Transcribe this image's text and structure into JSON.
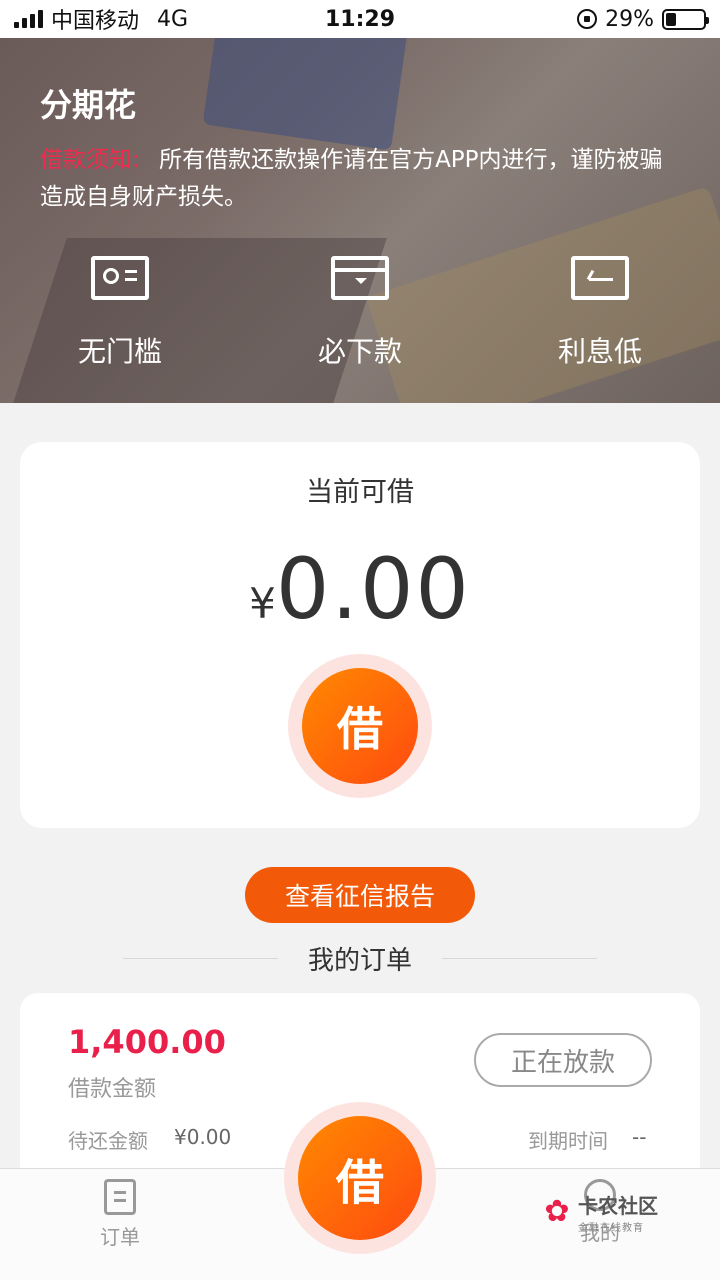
{
  "status_bar": {
    "carrier": "中国移动",
    "network": "4G",
    "time": "11:29",
    "battery": "29%",
    "battery_level": 0.29
  },
  "hero": {
    "title": "分期花",
    "notice_label": "借款须知:",
    "notice_text": "所有借款还款操作请在官方APP内进行，谨防被骗造成自身财产损失。",
    "features": [
      {
        "label": "无门槛",
        "icon": "id-card-icon"
      },
      {
        "label": "必下款",
        "icon": "card-icon"
      },
      {
        "label": "利息低",
        "icon": "low-rate-icon"
      }
    ]
  },
  "loan": {
    "caption": "当前可借",
    "currency": "¥",
    "amount": "0.00",
    "borrow_label": "借"
  },
  "credit_report_label": "查看征信报告",
  "orders_title": "我的订单",
  "order": {
    "amount": "1,400.00",
    "amount_label": "借款金额",
    "status": "正在放款",
    "pending_label": "待还金额",
    "pending_value": "¥0.00",
    "due_label": "到期时间",
    "due_value": "--"
  },
  "tabbar": {
    "orders_label": "订单",
    "borrow_label": "借",
    "mine_label": "我的"
  },
  "watermark": {
    "main": "卡农社区",
    "sub": "金融在线教育"
  },
  "colors": {
    "accent_orange": "#ff6a10",
    "notice_red": "#f22a4e",
    "amount_red": "#e8204a"
  }
}
